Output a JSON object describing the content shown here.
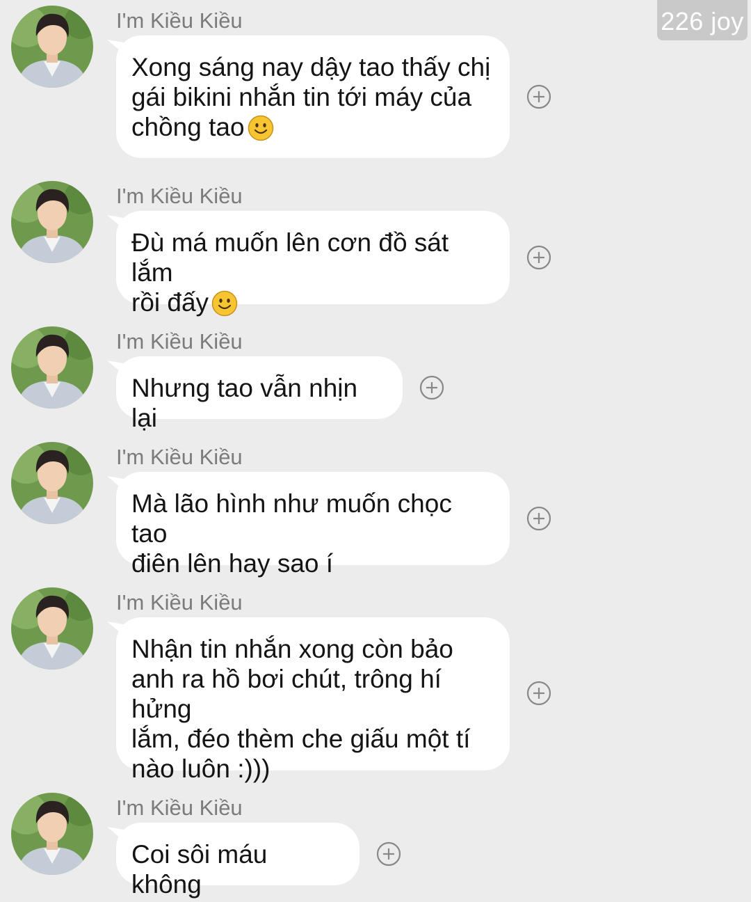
{
  "watermark": "226 joy",
  "messages": [
    {
      "sender": "I'm Kiều Kiều",
      "text": "Xong sáng nay dậy tao thấy chị\ngái bikini nhắn tin tới máy của\nchồng tao",
      "emoji": "slightly-smiling-face"
    },
    {
      "sender": "I'm Kiều Kiều",
      "text": "Đù má muốn lên cơn đồ sát lắm\nrồi đấy",
      "emoji": "slightly-smiling-face"
    },
    {
      "sender": "I'm Kiều Kiều",
      "text": "Nhưng tao vẫn nhịn lại",
      "emoji": null
    },
    {
      "sender": "I'm Kiều Kiều",
      "text": "Mà lão hình như muốn chọc tao\nđiên lên hay sao í",
      "emoji": null
    },
    {
      "sender": "I'm Kiều Kiều",
      "text": "Nhận tin nhắn xong còn bảo\nanh ra hồ bơi chút, trông hí hửng\nlắm, đéo thèm che giấu một tí\nnào luôn :)))",
      "emoji": null
    },
    {
      "sender": "I'm Kiều Kiều",
      "text": "Coi sôi máu không",
      "emoji": null
    }
  ],
  "icons": {
    "avatar": "profile-photo-icon",
    "react": "add-reaction-icon",
    "emoji": "slightly-smiling-face-icon"
  },
  "colors": {
    "background": "#ececec",
    "bubble": "#ffffff",
    "sender": "#7b7b7b",
    "emoji": "#f7c531"
  }
}
